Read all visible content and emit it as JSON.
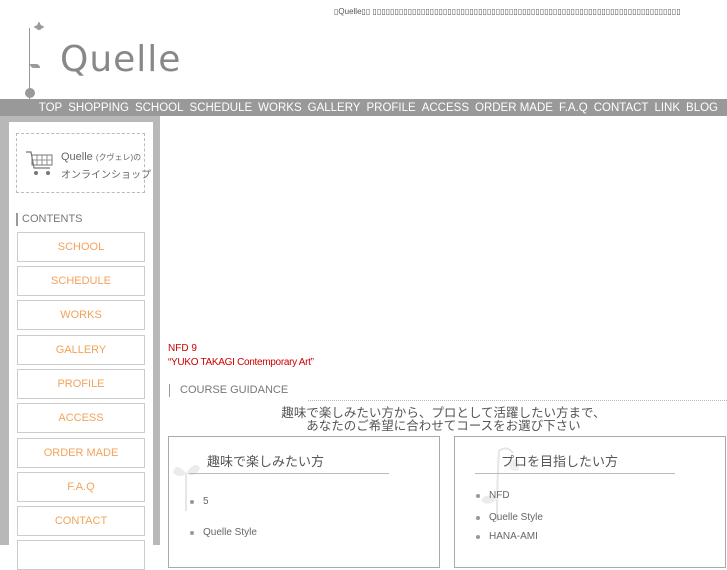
{
  "topline": "▯Quelle▯▯ ▯▯▯▯▯▯▯▯▯▯▯▯▯▯▯▯▯▯▯▯▯▯▯▯▯▯▯▯▯▯▯▯▯▯▯▯▯▯▯▯▯▯▯▯▯▯▯▯▯▯▯▯▯▯▯▯▯▯▯▯▯▯▯▯▯▯▯▯▯▯",
  "logo": {
    "text": "Quelle"
  },
  "nav": [
    "TOP",
    "SHOPPING",
    "SCHOOL",
    "SCHEDULE",
    "WORKS",
    "GALLERY",
    "PROFILE",
    "ACCESS",
    "ORDER MADE",
    "F.A.Q",
    "CONTACT",
    "LINK",
    "BLOG"
  ],
  "shop": {
    "title": "Quelle",
    "title_small": "(クヴェレ)の",
    "subtitle": "オンラインショップ"
  },
  "contents_label": "CONTENTS",
  "side_buttons": [
    "SCHOOL",
    "SCHEDULE",
    "WORKS",
    "GALLERY",
    "PROFILE",
    "ACCESS",
    "ORDER MADE",
    "F.A.Q",
    "CONTACT"
  ],
  "news": {
    "line1": "NFD  9",
    "line2": "“YUKO TAKAGI Contemporary Art”"
  },
  "course_label": "COURSE GUIDANCE",
  "intro": {
    "line1": "趣味で楽しみたい方から、プロとして活躍したい方まで、",
    "line2": "あなたのご希望に合わせてコースをお選び下さい"
  },
  "panels": {
    "left": {
      "title": "趣味で楽しみたい方",
      "items": [
        "5",
        "Quelle Style"
      ]
    },
    "right": {
      "title": "プロを目指したい方",
      "items": [
        "NFD",
        "Quelle Style",
        "HANA-AMI"
      ]
    }
  },
  "colors": {
    "accent": "#f3a35a",
    "nav_bg": "#999999",
    "news_red": "#cc0000"
  }
}
